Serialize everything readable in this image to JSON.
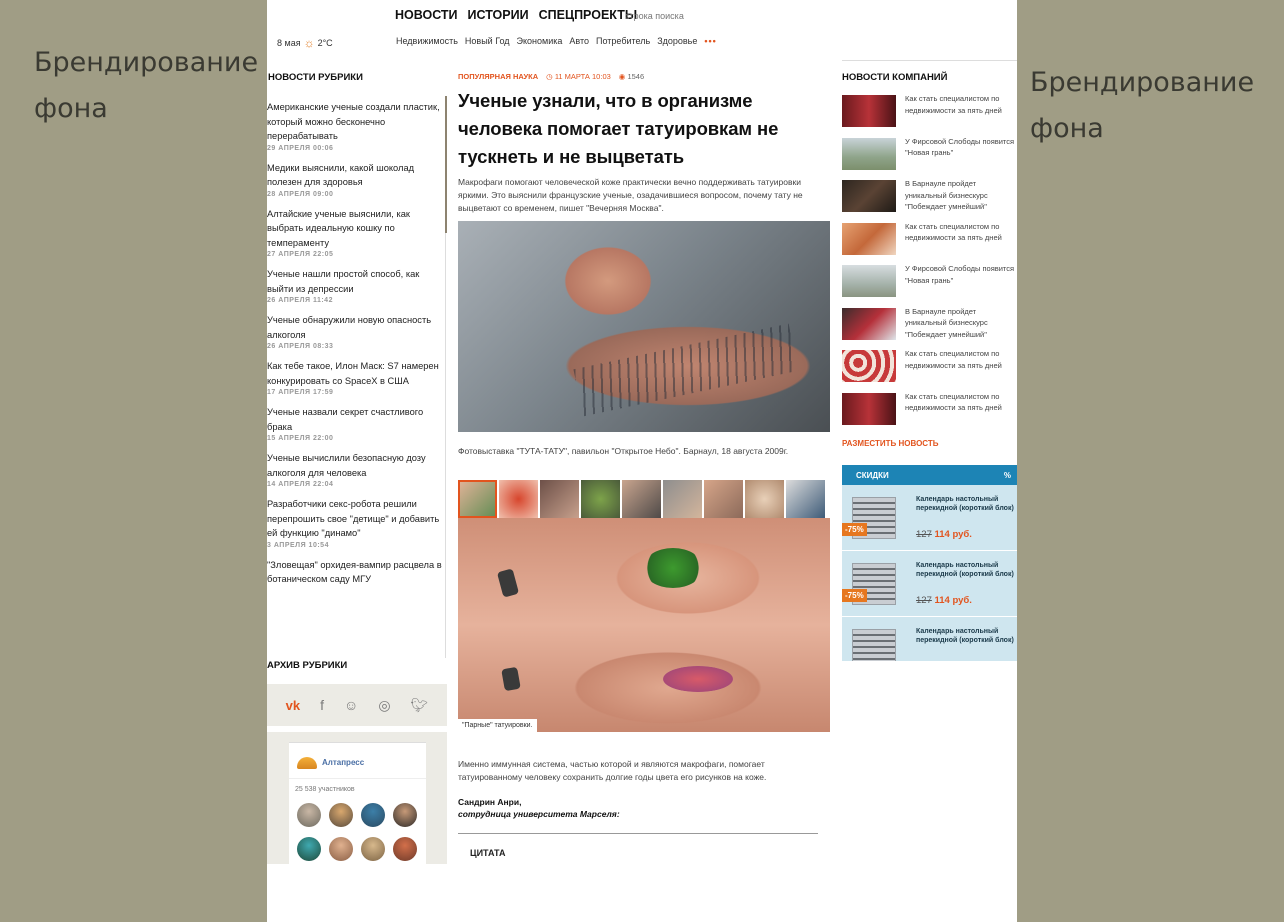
{
  "branding": {
    "left": "Брендирование фона",
    "right": "Брендирование фона"
  },
  "header": {
    "nav": [
      "НОВОСТИ",
      "ИСТОРИИ",
      "СПЕЦПРОЕКТЫ"
    ],
    "search_hint": "строка поиска",
    "date": "8 мая",
    "weather": "2°C",
    "subnav": [
      "Недвижимость",
      "Новый Год",
      "Экономика",
      "Авто",
      "Потребитель",
      "Здоровье"
    ],
    "more": "•••"
  },
  "left": {
    "title": "НОВОСТИ РУБРИКИ",
    "items": [
      {
        "title": "Американские ученые создали пластик, который можно бесконечно перерабатывать",
        "date": "29 АПРЕЛЯ 00:06"
      },
      {
        "title": "Медики выяснили, какой шоколад полезен для здоровья",
        "date": "28 АПРЕЛЯ 09:00"
      },
      {
        "title": "Алтайские ученые выяснили, как выбрать идеальную кошку по темпераменту",
        "date": "27 АПРЕЛЯ 22:05"
      },
      {
        "title": "Ученые нашли простой способ, как выйти из депрессии",
        "date": "26 АПРЕЛЯ 11:42"
      },
      {
        "title": "Ученые обнаружили новую опасность алкоголя",
        "date": "26 АПРЕЛЯ 08:33"
      },
      {
        "title": "Как тебе такое, Илон Маск: S7 намерен конкурировать со SpaceX в США",
        "date": "17 АПРЕЛЯ 17:59"
      },
      {
        "title": "Ученые назвали секрет счастливого брака",
        "date": "15 АПРЕЛЯ 22:00"
      },
      {
        "title": "Ученые вычислили безопасную дозу алкоголя для человека",
        "date": "14 АПРЕЛЯ 22:04"
      },
      {
        "title": "Разработчики секс-робота решили перепрошить свое \"детище\" и добавить ей функцию \"динамо\"",
        "date": "3 АПРЕЛЯ 10:54"
      },
      {
        "title": "\"Зловещая\" орхидея-вампир расцвела в ботаническом саду МГУ",
        "date": ""
      }
    ],
    "archive": "АРХИВ РУБРИКИ",
    "widget": {
      "name": "Алтапресс",
      "members": "25 538 участников"
    }
  },
  "article": {
    "rubric": "ПОПУЛЯРНАЯ НАУКА",
    "date": "11 МАРТА 10:03",
    "views": "1546",
    "headline": "Ученые узнали, что в организме человека помогает татуировкам не тускнеть и не выцветать",
    "lead": "Макрофаги помогают человеческой коже практически вечно поддерживать татуировки яркими. Это выяснили французские ученые, озадачившиеся вопросом, почему тату не выцветают со временем, пишет \"Вечерняя Москва\".",
    "photo_caption": "Фотовыставка \"ТУТА-ТАТУ\", павильон \"Открытое Небо\". Барнаул, 18 августа 2009г.",
    "gallery_caption": "\"Парные\" татуировки.",
    "body": "Именно иммунная система, частью которой и являются макрофаги, помогает татуированному человеку сохранить долгие годы цвета его рисунков на коже.",
    "author": "Сандрин Анри,",
    "author_role": "сотрудница университета Марселя:",
    "quote_title": "ЦИТАТА"
  },
  "right": {
    "title": "НОВОСТИ КОМПАНИЙ",
    "items": [
      "Как стать специалистом по недвижимости за пять дней",
      "У Фирсовой Слободы появится \"Новая грань\"",
      "В Барнауле пройдет уникальный бизнескурс \"Побеждает умнейший\"",
      "Как стать специалистом по недвижимости за пять дней",
      "У Фирсовой Слободы появится \"Новая грань\"",
      "В Барнауле пройдет уникальный бизнескурс \"Побеждает умнейший\"",
      "Как стать специалистом по недвижимости за пять дней",
      "Как стать специалистом по недвижимости за пять дней"
    ],
    "place_news": "РАЗМЕСТИТЬ НОВОСТЬ",
    "discounts": {
      "title": "СКИДКИ",
      "badge": "%",
      "items": [
        {
          "name": "Календарь настольный перекидной (короткий блок)",
          "discount": "-75%",
          "old": "127",
          "new": "114 руб."
        },
        {
          "name": "Календарь настольный перекидной (короткий блок)",
          "discount": "-75%",
          "old": "127",
          "new": "114 руб."
        },
        {
          "name": "Календарь настольный перекидной (короткий блок)",
          "discount": "",
          "old": "",
          "new": ""
        }
      ]
    }
  },
  "colors": {
    "accent": "#e2541e",
    "branding_bg": "#a09d85",
    "discount_header": "#1d84b5"
  }
}
